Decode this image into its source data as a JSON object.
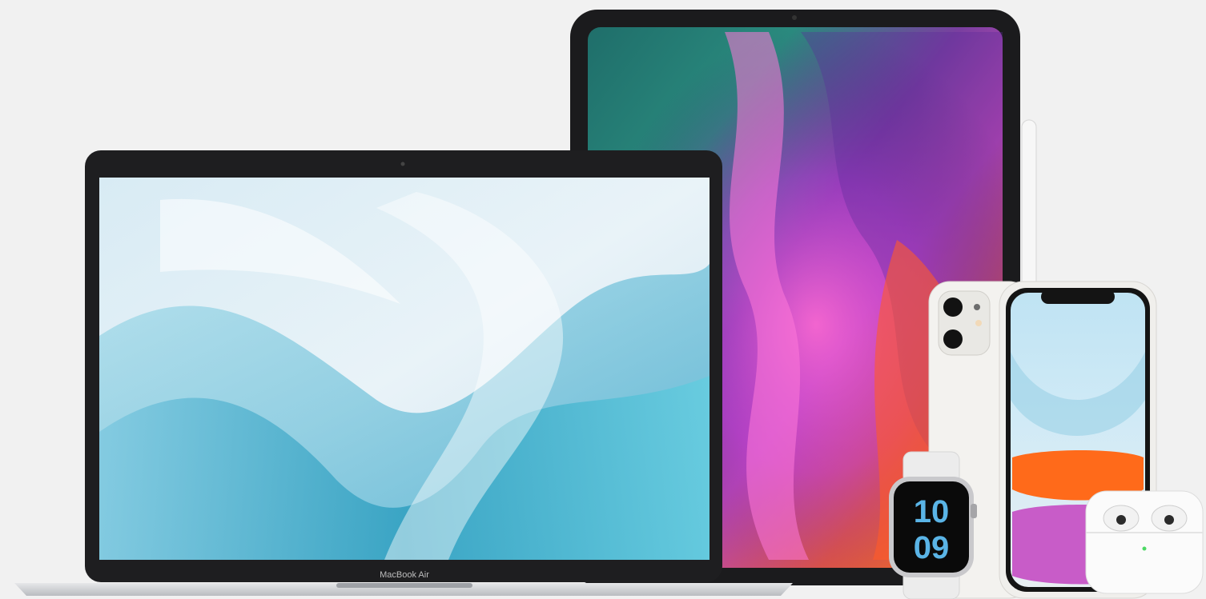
{
  "scene": {
    "background": "#f1f1f1"
  },
  "devices": {
    "laptop": {
      "bezel_label": "MacBook Air"
    },
    "watch": {
      "hours": "10",
      "minutes": "09",
      "face_accent": "#5ab4e6"
    },
    "ipad": {
      "icon": "tablet-icon"
    },
    "pencil": {
      "icon": "stylus-icon"
    },
    "iphone": {
      "icon": "phone-icon"
    },
    "airpods": {
      "icon": "earbuds-icon",
      "status_light": "#4cd964"
    }
  }
}
